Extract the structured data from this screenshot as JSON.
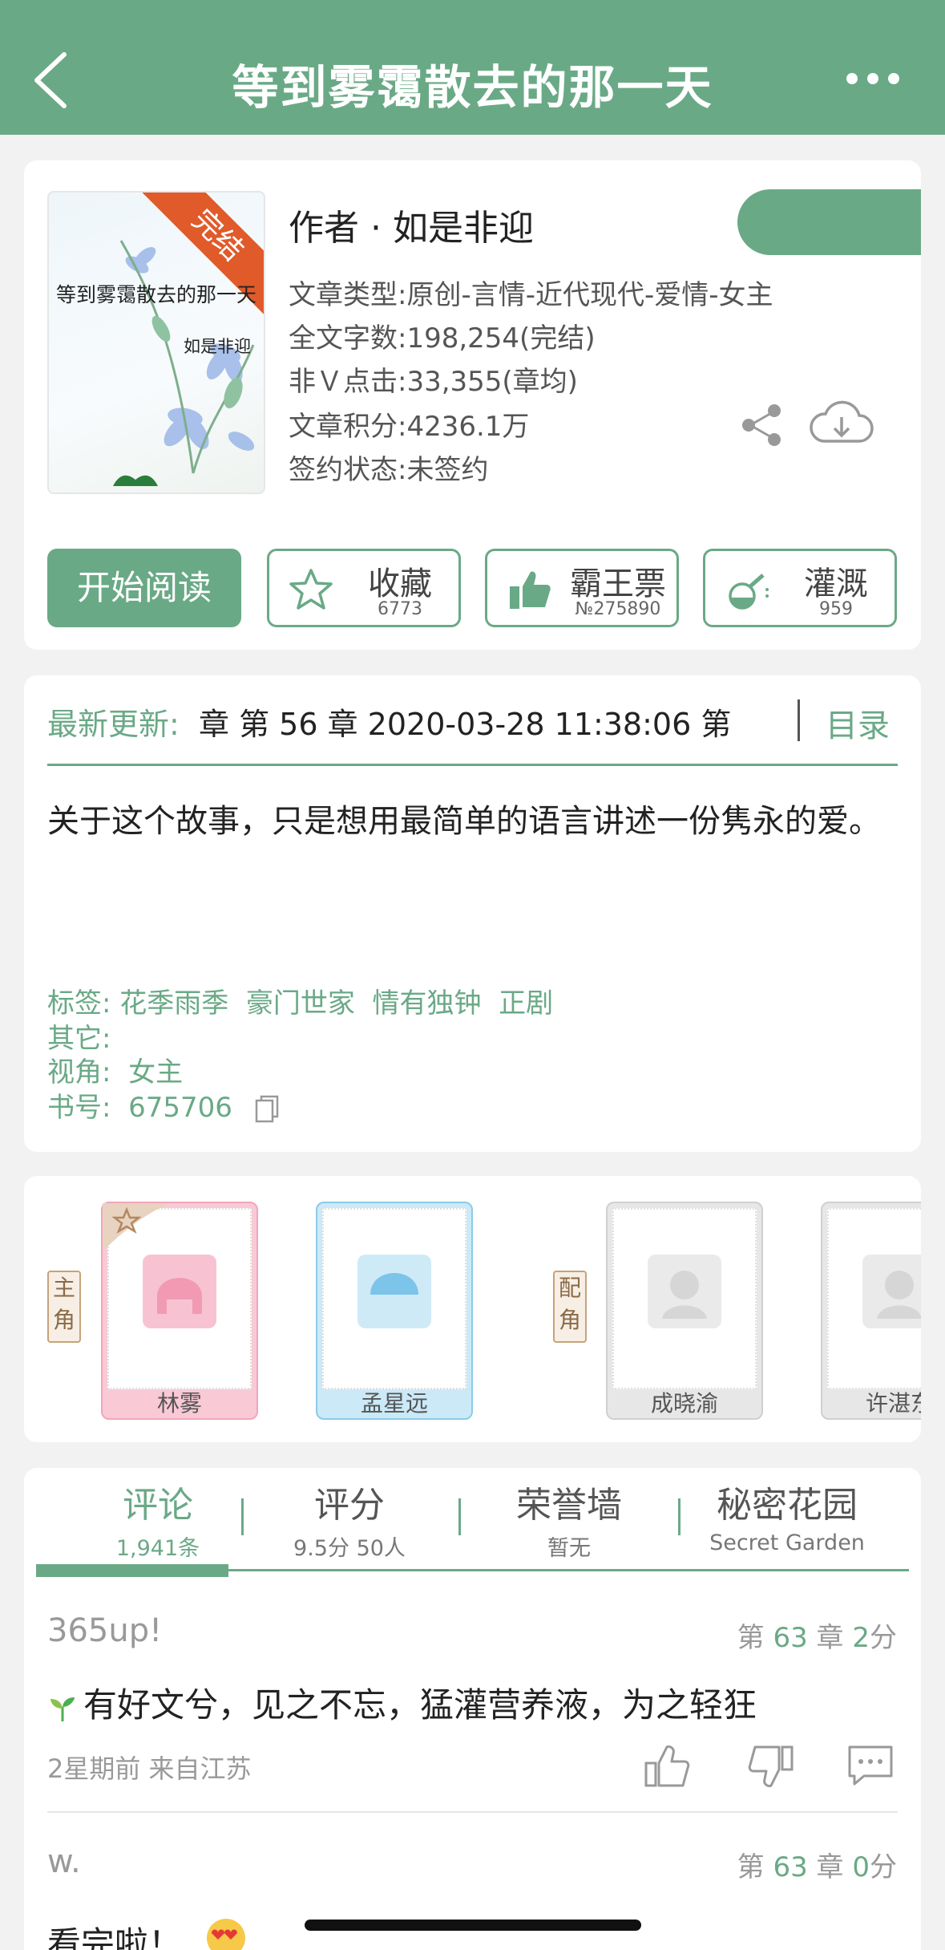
{
  "header": {
    "title": "等到雾霭散去的那一天"
  },
  "book": {
    "cover_badge": "完结",
    "cover_title": "等到雾霭散去的那一天",
    "cover_author": "如是非迎",
    "author": "作者 · 如是非迎",
    "genre": "文章类型:原创-言情-近代现代-爱情-女主",
    "word_count": "全文字数:198,254(完结)",
    "clicks": "非Ｖ点击:33,355(章均)",
    "points": "文章积分:4236.1万",
    "sign_status": "签约状态:未签约"
  },
  "actions": {
    "read": "开始阅读",
    "collect": {
      "label": "收藏",
      "count": "6773"
    },
    "vote": {
      "label": "霸王票",
      "count": "№275890"
    },
    "nourish": {
      "label": "灌溉",
      "count": "959"
    }
  },
  "update": {
    "label": "最新更新:",
    "text": "章 第 56 章 2020-03-28 11:38:06  第",
    "toc": "目录",
    "intro": "关于这个故事，只是想用最简单的语言讲述一份隽永的爱。",
    "tags": "标签: 花季雨季  豪门世家  情有独钟  正剧",
    "other": "其它:",
    "view": "视角:  女主",
    "book_id": "书号:  675706"
  },
  "roles": {
    "main_label": "主角",
    "support_label": "配角",
    "main": [
      {
        "name": "林雾"
      },
      {
        "name": "孟星远"
      }
    ],
    "support": [
      {
        "name": "成晓渝"
      },
      {
        "name": "许湛东"
      }
    ]
  },
  "tabs": [
    {
      "name": "评论",
      "sub": "1,941条"
    },
    {
      "name": "评分",
      "sub": "9.5分 50人"
    },
    {
      "name": "荣誉墙",
      "sub": "暂无"
    },
    {
      "name": "秘密花园",
      "sub": "Secret Garden"
    }
  ],
  "comments": [
    {
      "user": "365up!",
      "chapter_prefix": "第",
      "chapter": "63",
      "chapter_mid": "章",
      "minutes": "2",
      "minutes_suffix": "分",
      "text": "有好文兮，见之不忘，猛灌营养液，为之轻狂",
      "meta": "2星期前  来自江苏"
    },
    {
      "user": "w.",
      "chapter_prefix": "第",
      "chapter": "63",
      "chapter_mid": "章",
      "minutes": "0",
      "minutes_suffix": "分",
      "text": "看完啦！"
    }
  ],
  "colors": {
    "accent": "#6aa986",
    "badge": "#e05a2a"
  }
}
